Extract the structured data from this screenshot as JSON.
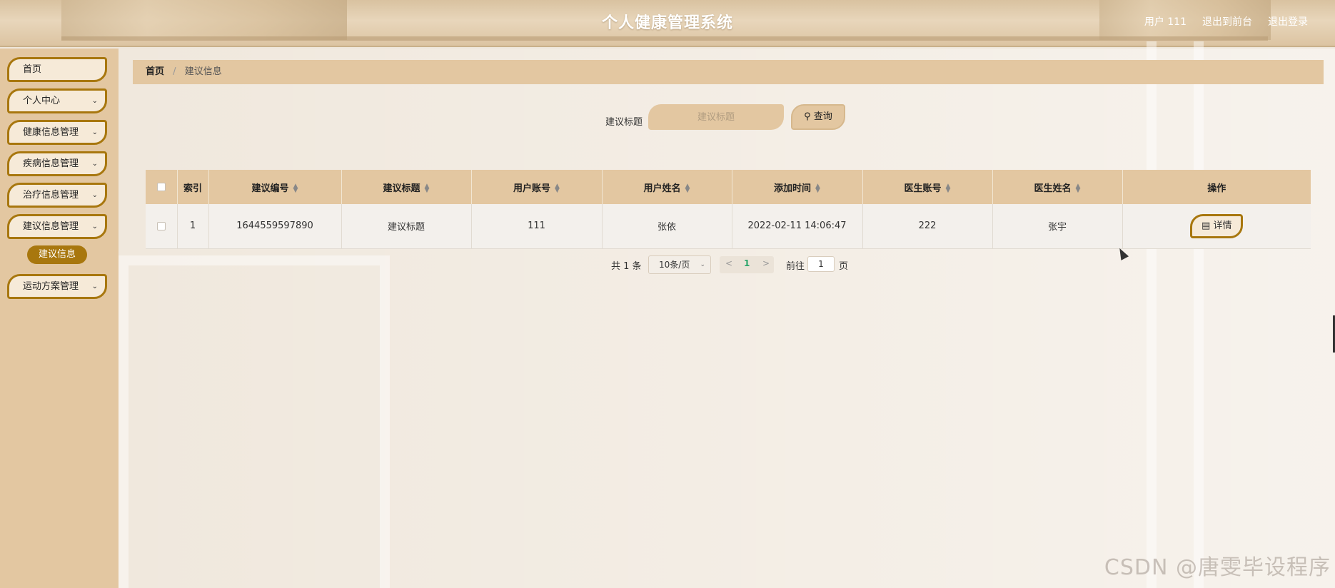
{
  "header": {
    "title": "个人健康管理系统",
    "user_label": "用户 111",
    "to_front": "退出到前台",
    "logout": "退出登录"
  },
  "sidebar": {
    "items": [
      {
        "label": "首页",
        "has_children": false
      },
      {
        "label": "个人中心",
        "has_children": true
      },
      {
        "label": "健康信息管理",
        "has_children": true
      },
      {
        "label": "疾病信息管理",
        "has_children": true
      },
      {
        "label": "治疗信息管理",
        "has_children": true
      },
      {
        "label": "建议信息管理",
        "has_children": true
      },
      {
        "label": "运动方案管理",
        "has_children": true
      }
    ],
    "active_sub": "建议信息"
  },
  "breadcrumb": {
    "home": "首页",
    "separator": "/",
    "current": "建议信息"
  },
  "search": {
    "label": "建议标题",
    "placeholder": "建议标题",
    "button": "查询"
  },
  "table": {
    "columns": [
      "索引",
      "建议编号",
      "建议标题",
      "用户账号",
      "用户姓名",
      "添加时间",
      "医生账号",
      "医生姓名",
      "操作"
    ],
    "rows": [
      {
        "index": "1",
        "code": "1644559597890",
        "title": "建议标题",
        "user_account": "111",
        "user_name": "张依",
        "added_time": "2022-02-11 14:06:47",
        "doctor_account": "222",
        "doctor_name": "张宇",
        "action": "详情"
      }
    ]
  },
  "pagination": {
    "total": "共 1 条",
    "page_size": "10条/页",
    "current_page": "1",
    "goto_label": "前往",
    "goto_value": "1",
    "page_suffix": "页"
  },
  "watermark": "CSDN @唐雯毕设程序",
  "colors": {
    "accent": "#a8770e",
    "sidebar_bg": "#e3c7a1",
    "header_title": "#ffffff"
  }
}
